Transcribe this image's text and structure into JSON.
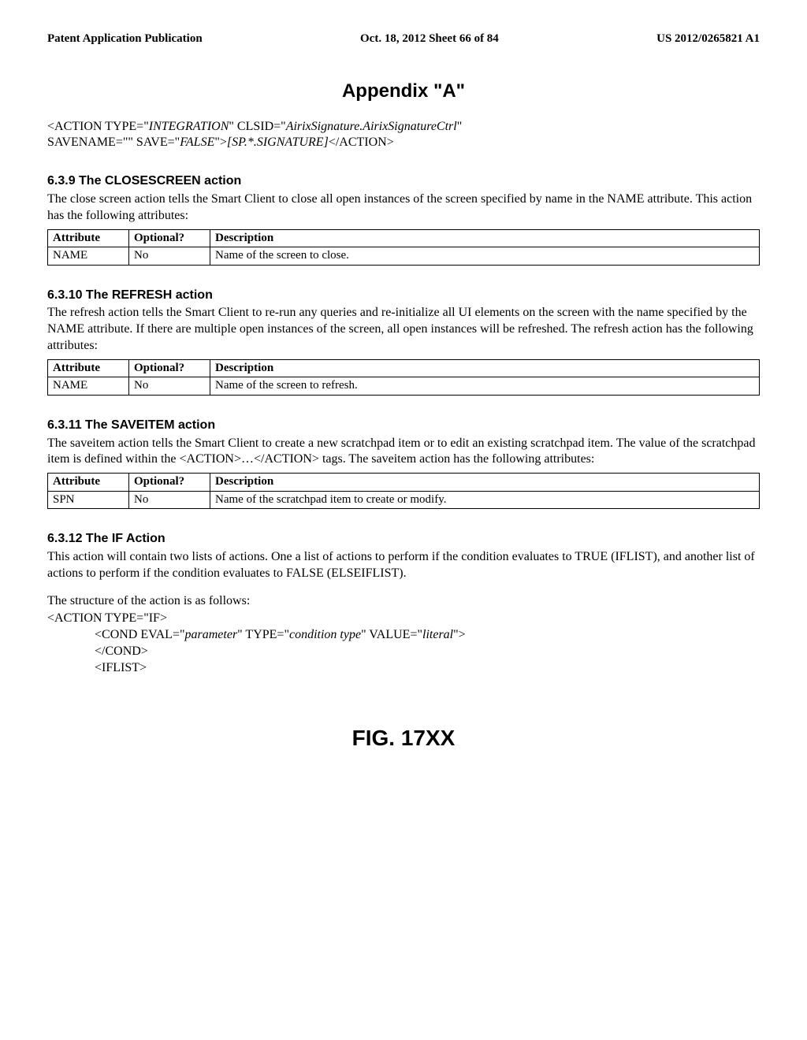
{
  "header": {
    "left": "Patent Application Publication",
    "center": "Oct. 18, 2012  Sheet 66 of 84",
    "right": "US 2012/0265821 A1"
  },
  "appendix_title": "Appendix \"A\"",
  "code_example": {
    "line1_a": "<ACTION TYPE=\"",
    "line1_b": "INTEGRATION",
    "line1_c": "\" CLSID=\"",
    "line1_d": "AirixSignature.AirixSignatureCtrl",
    "line1_e": "\"",
    "line2_a": "SAVENAME=\"\" SAVE=\"",
    "line2_b": "FALSE",
    "line2_c": "\">",
    "line2_d": "[SP.*.SIGNATURE]",
    "line2_e": "</ACTION>"
  },
  "s639": {
    "heading": "6.3.9  The CLOSESCREEN action",
    "para": "The close screen action tells the Smart Client to close all open instances of the screen specified by name in the NAME attribute. This action has the following attributes:",
    "th1": "Attribute",
    "th2": "Optional?",
    "th3": "Description",
    "td1": "NAME",
    "td2": "No",
    "td3": "Name of the screen to close."
  },
  "s6310": {
    "heading": "6.3.10 The REFRESH action",
    "para": "The refresh action tells the Smart Client to re-run any queries and re-initialize all UI elements on the screen with the name specified by the NAME attribute. If there are multiple open instances of the screen, all open instances will be refreshed. The refresh action has the following attributes:",
    "th1": "Attribute",
    "th2": "Optional?",
    "th3": "Description",
    "td1": "NAME",
    "td2": "No",
    "td3": "Name of the screen to refresh."
  },
  "s6311": {
    "heading": "6.3.11 The SAVEITEM action",
    "para": "The saveitem action tells the Smart Client to create a new scratchpad item or to edit an existing scratchpad item. The value of the scratchpad item is defined within the <ACTION>…</ACTION> tags.  The saveitem action has the following attributes:",
    "th1": "Attribute",
    "th2": "Optional?",
    "th3": "Description",
    "td1": "SPN",
    "td2": "No",
    "td3": "Name of the scratchpad item to create or modify."
  },
  "s6312": {
    "heading": "6.3.12 The IF Action",
    "para1": "This action will contain two lists of actions.  One a list of actions to perform if the condition evaluates to TRUE (IFLIST), and another list of actions to perform if the condition evaluates to FALSE (ELSEIFLIST).",
    "para2": "The structure of the action is as follows:",
    "c1": "<ACTION TYPE=\"IF>",
    "c2a": "<COND EVAL=\"",
    "c2b": "parameter",
    "c2c": "\" TYPE=\"",
    "c2d": "condition type",
    "c2e": "\" VALUE=\"",
    "c2f": "literal",
    "c2g": "\">",
    "c3": "</COND>",
    "c4": "<IFLIST>"
  },
  "figure_label": "FIG. 17XX"
}
